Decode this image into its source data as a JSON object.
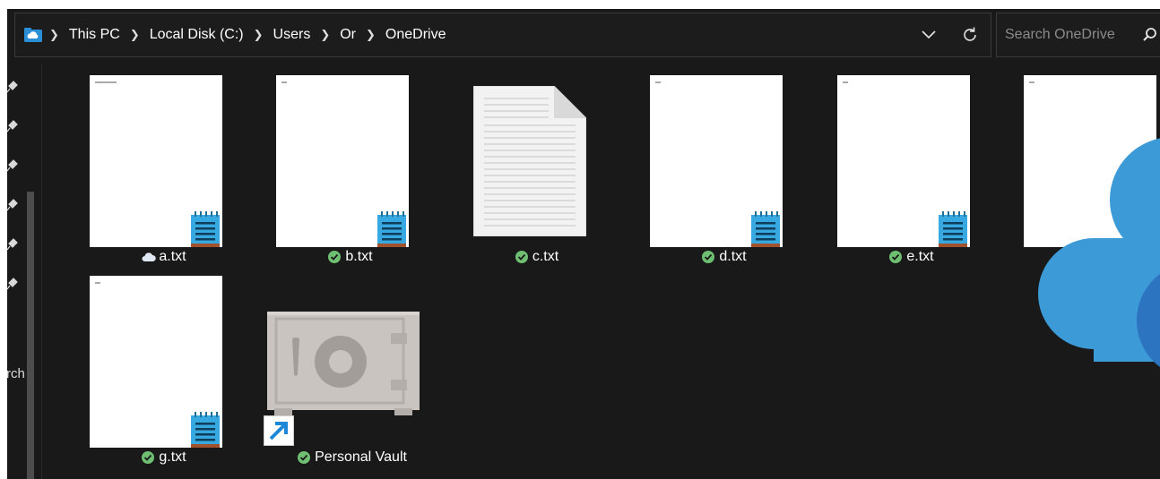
{
  "address_bar": {
    "breadcrumbs": [
      "This PC",
      "Local Disk (C:)",
      "Users",
      "Or",
      "OneDrive"
    ]
  },
  "search": {
    "placeholder": "Search OneDrive"
  },
  "nav": {
    "partial_label": "rch"
  },
  "files": [
    {
      "name": "a.txt",
      "status": "cloud-only"
    },
    {
      "name": "b.txt",
      "status": "synced"
    },
    {
      "name": "c.txt",
      "status": "synced"
    },
    {
      "name": "d.txt",
      "status": "synced"
    },
    {
      "name": "e.txt",
      "status": "synced"
    },
    {
      "name": "g.txt",
      "status": "synced"
    },
    {
      "name": "Personal Vault",
      "status": "synced"
    }
  ],
  "colors": {
    "background": "#191919",
    "synced_check": "#6fbf73",
    "cloud_blue": "#3c9ad6",
    "notepad_blue": "#38a9e0"
  }
}
